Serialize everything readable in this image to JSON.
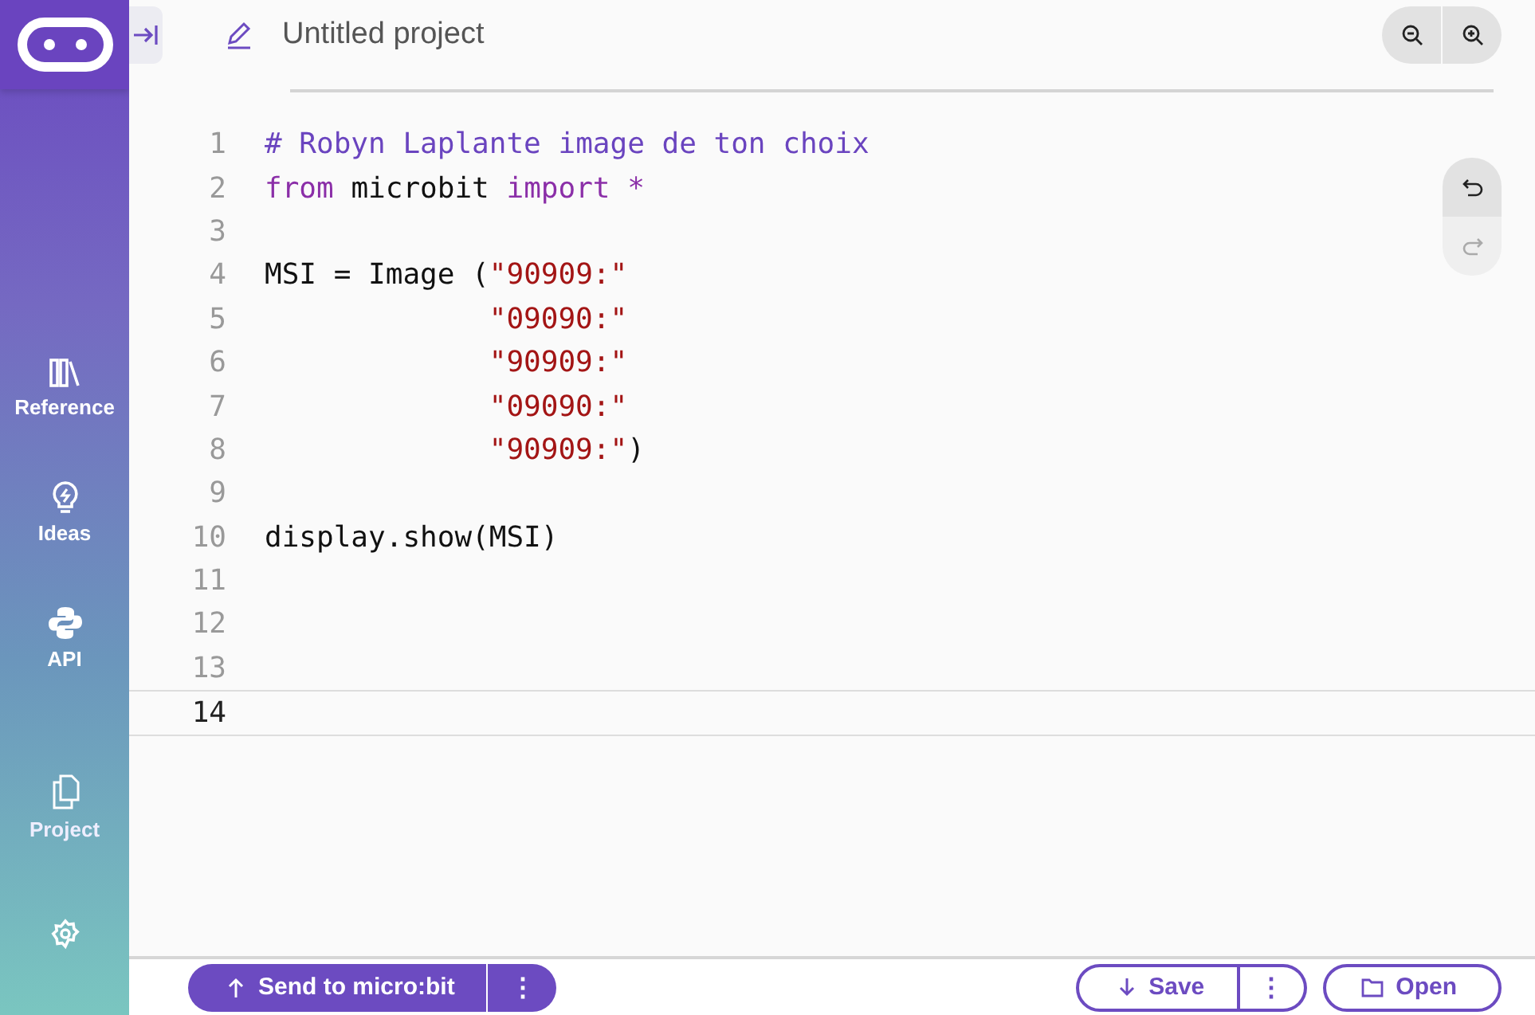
{
  "header": {
    "project_name": "Untitled project"
  },
  "sidebar": {
    "items": [
      {
        "label": "Reference"
      },
      {
        "label": "Ideas"
      },
      {
        "label": "API"
      },
      {
        "label": "Project"
      }
    ]
  },
  "editor": {
    "lines": [
      {
        "number": "1",
        "current": false,
        "tokens": [
          {
            "kind": "comment",
            "text": "# Robyn Laplante image de ton choix"
          }
        ]
      },
      {
        "number": "2",
        "current": false,
        "tokens": [
          {
            "kind": "keyword",
            "text": "from"
          },
          {
            "kind": "plain",
            "text": " microbit "
          },
          {
            "kind": "keyword",
            "text": "import *"
          }
        ]
      },
      {
        "number": "3",
        "current": false
      },
      {
        "number": "4",
        "current": false,
        "tokens": [
          {
            "kind": "plain",
            "text": "MSI = Image ("
          },
          {
            "kind": "string",
            "text": "\"90909:\""
          }
        ]
      },
      {
        "number": "5",
        "current": false,
        "indented": true,
        "tokens": [
          {
            "kind": "string",
            "text": "\"09090:\""
          }
        ]
      },
      {
        "number": "6",
        "current": false,
        "indented": true,
        "tokens": [
          {
            "kind": "string",
            "text": "\"90909:\""
          }
        ]
      },
      {
        "number": "7",
        "current": false,
        "indented": true,
        "tokens": [
          {
            "kind": "string",
            "text": "\"09090:\""
          }
        ]
      },
      {
        "number": "8",
        "current": false,
        "indented": true,
        "tokens": [
          {
            "kind": "string",
            "text": "\"90909:\""
          },
          {
            "kind": "plain",
            "text": ")"
          }
        ]
      },
      {
        "number": "9",
        "current": false
      },
      {
        "number": "10",
        "current": false,
        "tokens": [
          {
            "kind": "plain",
            "text": "display.show(MSI)"
          }
        ]
      },
      {
        "number": "11",
        "current": false
      },
      {
        "number": "12",
        "current": false
      },
      {
        "number": "13",
        "current": false
      },
      {
        "number": "14",
        "current": true
      }
    ]
  },
  "footer": {
    "send_button": "Send to micro:bit",
    "send_more_button": "⋮",
    "save_button": "Save",
    "save_more_button": "⋮",
    "open_button": "Open"
  }
}
